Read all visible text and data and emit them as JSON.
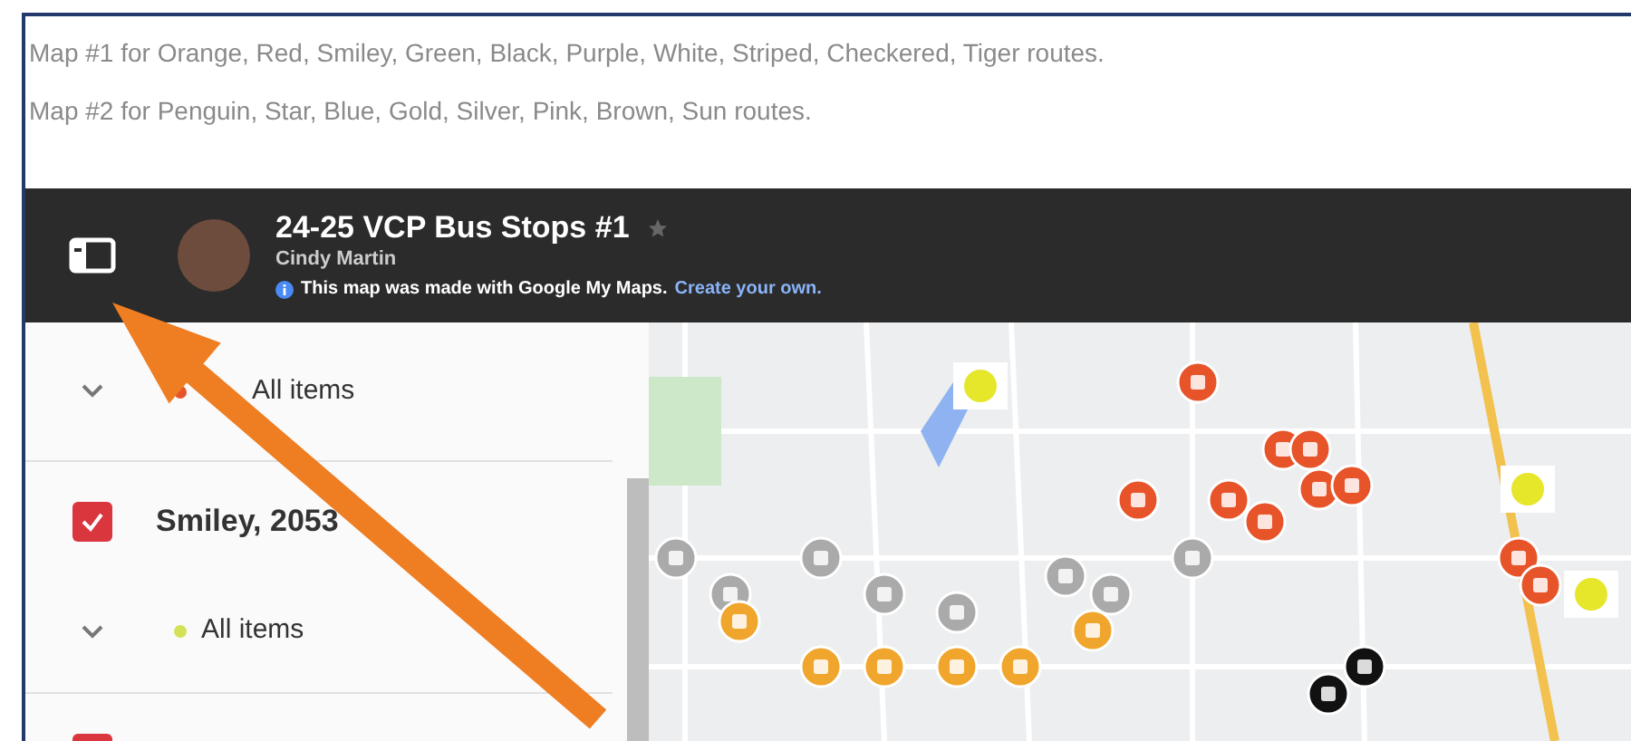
{
  "intro_lines": [
    "Map #1 for Orange, Red, Smiley, Green, Black, Purple, White, Striped, Checkered, Tiger routes.",
    "Map #2 for Penguin, Star, Blue, Gold, Silver, Pink, Brown, Sun routes."
  ],
  "map_header": {
    "title": "24-25 VCP Bus Stops #1",
    "author": "Cindy Martin",
    "notice": "This map was made with Google My Maps.",
    "link": "Create your own."
  },
  "sidebar_rows": [
    {
      "kind": "legend",
      "label": "All items",
      "color": "#e8542a",
      "expanded": true
    },
    {
      "kind": "layer",
      "label": "Smiley, 2053",
      "checked": true
    },
    {
      "kind": "legend",
      "label": "All items",
      "color": "#d4e157",
      "expanded": true
    },
    {
      "kind": "layer",
      "checked": true
    }
  ]
}
